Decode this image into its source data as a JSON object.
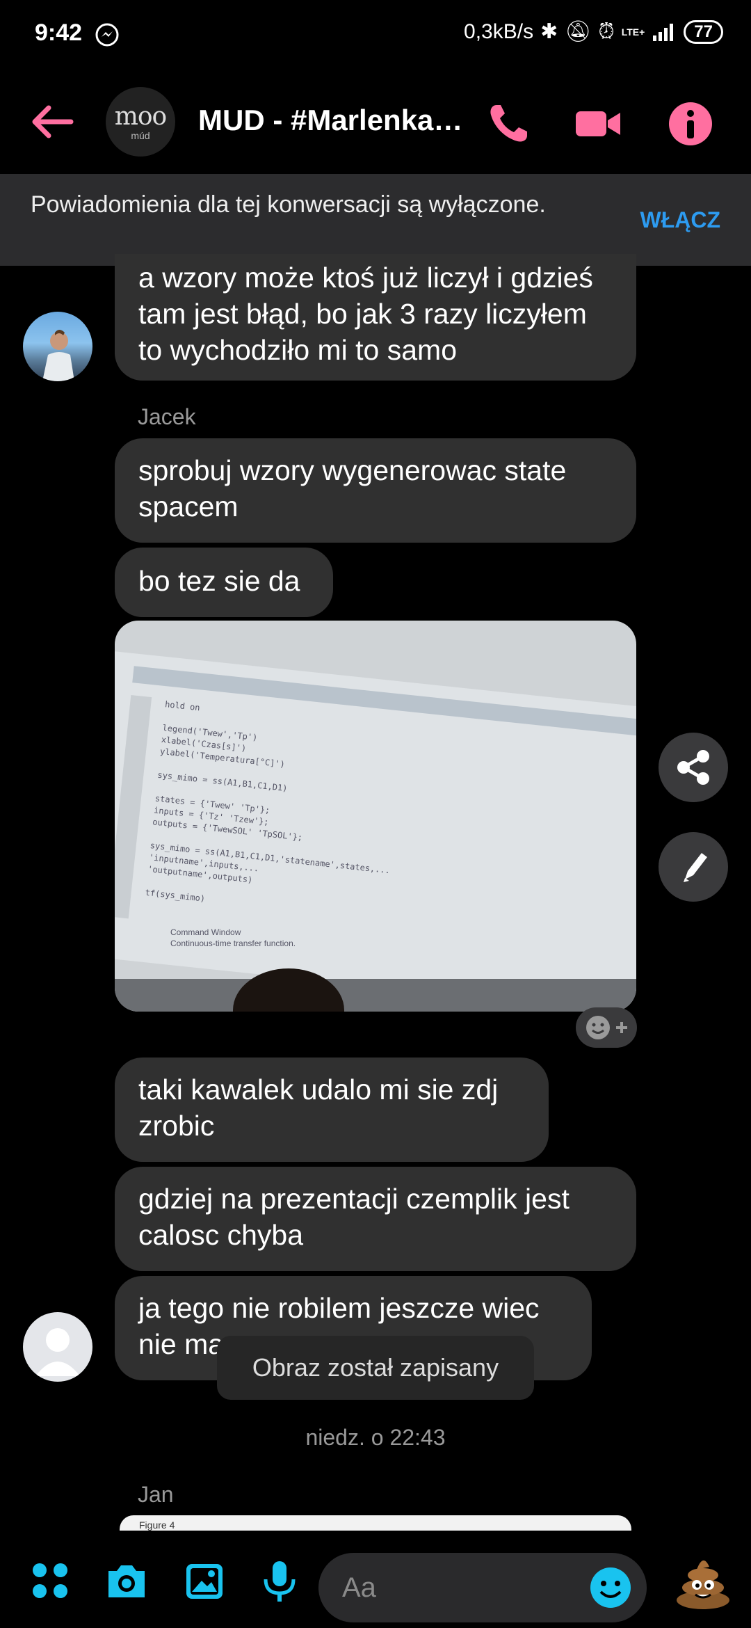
{
  "status_bar": {
    "time": "9:42",
    "net_speed": "0,3kB/s",
    "signal_label": "LTE+",
    "battery": "77"
  },
  "header": {
    "title": "MUD - #Marlenka…",
    "group_avatar_text": "moo",
    "group_avatar_sub": "múd",
    "accent_color": "#ff6fa0"
  },
  "notification_banner": {
    "text": "Powiadomienia dla tej konwersacji są wyłączone.",
    "button_label": "WŁĄCZ"
  },
  "messages": [
    {
      "id": "m1",
      "text": "a wzory może ktoś już liczył i gdzieś tam jest błąd, bo jak 3 razy liczyłem to wychodziło mi to samo"
    },
    {
      "id": "m2",
      "sender": "Jacek",
      "text": "sprobuj wzory wygenerowac state spacem"
    },
    {
      "id": "m3",
      "text": "bo tez sie da"
    },
    {
      "id": "m4",
      "text": "taki kawalek udalo mi sie zdj zrobic"
    },
    {
      "id": "m5",
      "text": "gdziej na prezentacji czemplik jest calosc chyba"
    },
    {
      "id": "m6",
      "text": "ja tego nie robilem jeszcze wiec nie ma"
    }
  ],
  "photo_code_lines": [
    "hold on",
    "",
    "legend('Twew','Tp')",
    "xlabel('Czas[s]')",
    "ylabel('Temperatura[°C]')",
    "",
    "sys_mimo = ss(A1,B1,C1,D1)",
    "",
    "states = {'Twew' 'Tp'};",
    "inputs = {'Tz' 'Tzew'};",
    "outputs = {'TwewSOL' 'TpSOL'};",
    "",
    "sys_mimo = ss(A1,B1,C1,D1,'statename',states,...",
    "'inputname',inputs,...",
    "'outputname',outputs)",
    "",
    "tf(sys_mimo)"
  ],
  "photo_caption_lines": [
    "Command Window",
    "Continuous-time transfer function."
  ],
  "toast": "Obraz został zapisany",
  "timestamp": "niedz. o 22:43",
  "next_sender": "Jan",
  "jan_preview_title": "Figure 4",
  "composer": {
    "placeholder": "Aa"
  }
}
